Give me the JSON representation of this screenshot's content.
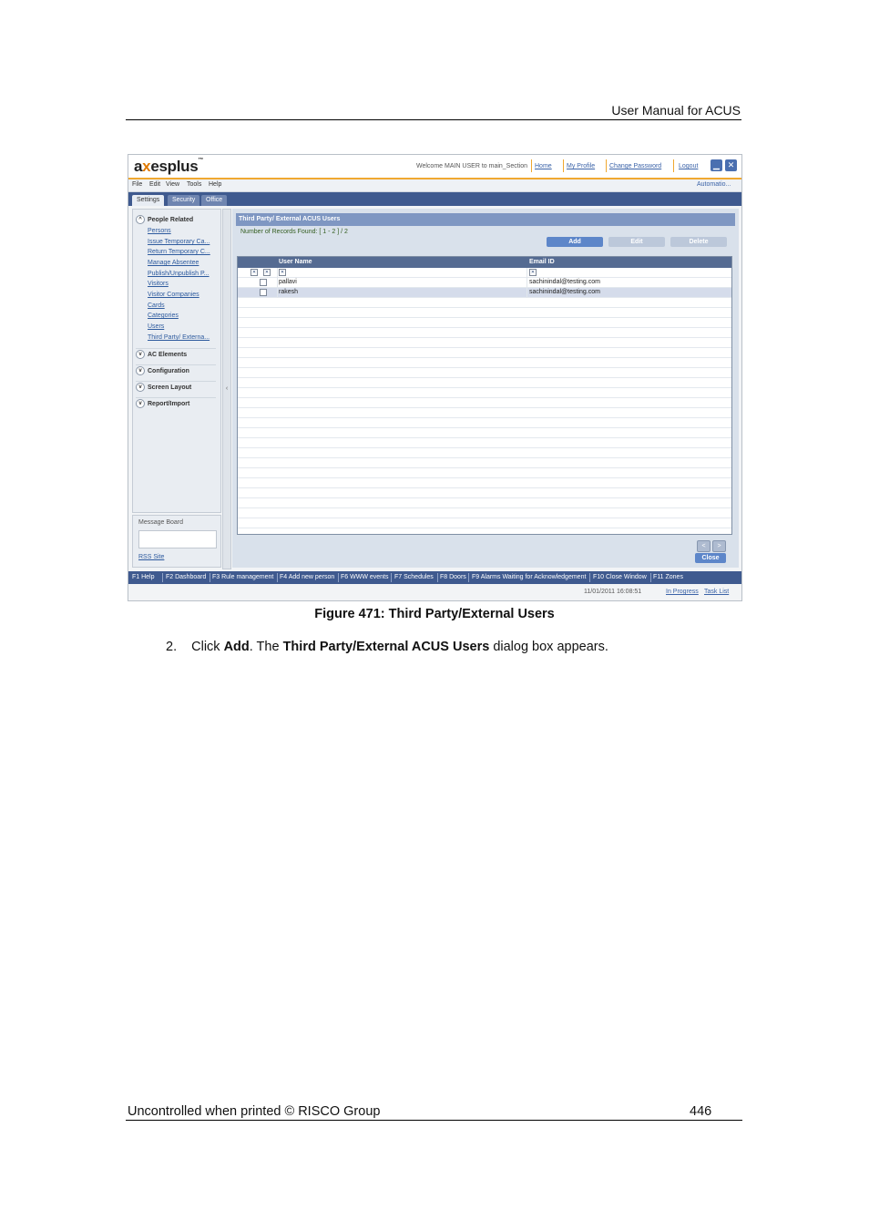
{
  "header": {
    "title": "User Manual for ACUS"
  },
  "app": {
    "logo_a": "a",
    "logo_x": "x",
    "logo_rest": "esplus",
    "logo_tm": "™",
    "welcome": "Welcome MAIN USER  to main_Section",
    "links": {
      "home": "Home",
      "my_profile": "My Profile",
      "change_password": "Change Password",
      "logout": "Logout"
    },
    "menu": [
      "File",
      "Edit",
      "View",
      "Tools",
      "Help"
    ],
    "automation": "Automatio...",
    "tabs": [
      "Settings",
      "Security",
      "Office"
    ],
    "left_panel": {
      "section": "People Related",
      "items": [
        "Persons",
        "Issue Temporary Ca...",
        "Return Temporary C...",
        "Manage Absentee",
        "Publish/Unpublish P...",
        "Visitors",
        "Visitor Companies",
        "Cards",
        "Categories",
        "Users",
        "Third Party/ Externa..."
      ],
      "sections": [
        "AC Elements",
        "Configuration",
        "Screen Layout",
        "Report/Import"
      ]
    },
    "message_board": {
      "title": "Message Board",
      "rss": "RSS Site"
    },
    "collapse_arrow": "‹",
    "main": {
      "title": "Third Party/ External ACUS Users",
      "record_count": "Number of Records Found: [ 1 - 2 ] / 2",
      "buttons": {
        "add": "Add",
        "edit": "Edit",
        "delete": "Delete",
        "close": "Close"
      },
      "nav": {
        "prev": "<",
        "next": ">"
      },
      "columns": [
        "User Name",
        "Email ID"
      ],
      "rows": [
        {
          "user": "pallavi",
          "email": "sachinindal@testing.com"
        },
        {
          "user": "rakesh",
          "email": "sachinindal@testing.com"
        }
      ]
    },
    "fkeys": [
      "F1 Help",
      "F2 Dashboard",
      "F3 Rule management",
      "F4 Add new person",
      "F6 WWW events",
      "F7 Schedules",
      "F8 Doors",
      "F9 Alarms Waiting for Acknowledgement",
      "F10 Close Window",
      "F11 Zones"
    ],
    "status": {
      "datetime": "11/01/2011 16:08:51",
      "in_progress": "In Progress",
      "task_list": "Task List"
    },
    "colors": {
      "accent": "#f0a830",
      "tab_bar": "#3f5a8f",
      "button": "#5d86c9",
      "link": "#2d5a9e"
    }
  },
  "caption": "Figure 471: Third Party/External Users",
  "step": {
    "number": "2.",
    "text_1": "Click ",
    "bold_1": "Add",
    "text_2": ". The ",
    "bold_2": "Third Party/External ACUS Users",
    "text_3": " dialog box appears."
  },
  "footer": {
    "left": "Uncontrolled when printed © RISCO Group",
    "page": "446"
  }
}
